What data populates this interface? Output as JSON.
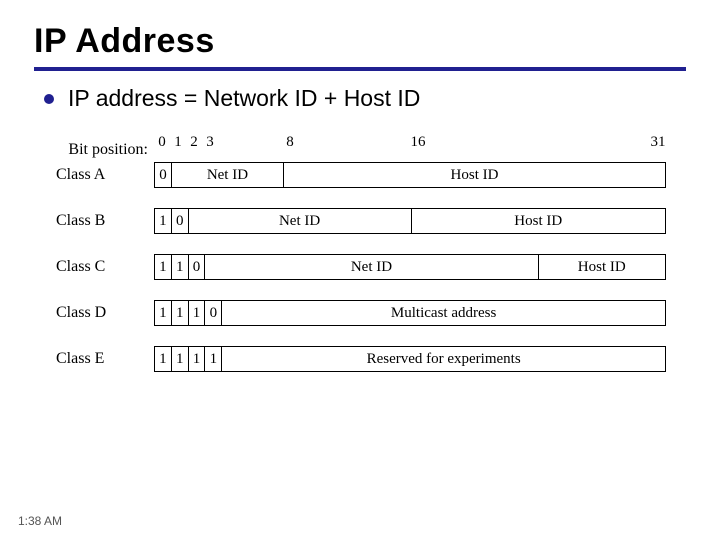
{
  "title": "IP Address",
  "bullet": "IP address = Network ID + Host ID",
  "bit_position_label": "Bit position:",
  "bit_ticks": {
    "b0": "0",
    "b1": "1",
    "b2": "2",
    "b3": "3",
    "b8": "8",
    "b16": "16",
    "b31": "31"
  },
  "labels": {
    "net_id": "Net ID",
    "host_id": "Host ID",
    "multicast": "Multicast address",
    "reserved": "Reserved for experiments"
  },
  "classes": {
    "a": {
      "name": "Class A",
      "prefix": [
        "0"
      ]
    },
    "b": {
      "name": "Class B",
      "prefix": [
        "1",
        "0"
      ]
    },
    "c": {
      "name": "Class C",
      "prefix": [
        "1",
        "1",
        "0"
      ]
    },
    "d": {
      "name": "Class D",
      "prefix": [
        "1",
        "1",
        "1",
        "0"
      ]
    },
    "e": {
      "name": "Class E",
      "prefix": [
        "1",
        "1",
        "1",
        "1"
      ]
    }
  },
  "footer_time": "1:38 AM",
  "chart_data": {
    "type": "table",
    "title": "IPv4 address class layout (32 bits)",
    "bit_positions_shown": [
      0,
      1,
      2,
      3,
      8,
      16,
      31
    ],
    "rows": [
      {
        "class": "A",
        "prefix_bits": "0",
        "net_id_bits": "1-7",
        "host_id_bits": "8-31"
      },
      {
        "class": "B",
        "prefix_bits": "10",
        "net_id_bits": "2-15",
        "host_id_bits": "16-31"
      },
      {
        "class": "C",
        "prefix_bits": "110",
        "net_id_bits": "3-23",
        "host_id_bits": "24-31"
      },
      {
        "class": "D",
        "prefix_bits": "1110",
        "payload": "Multicast address",
        "payload_bits": "4-31"
      },
      {
        "class": "E",
        "prefix_bits": "1111",
        "payload": "Reserved for experiments",
        "payload_bits": "4-31"
      }
    ]
  }
}
